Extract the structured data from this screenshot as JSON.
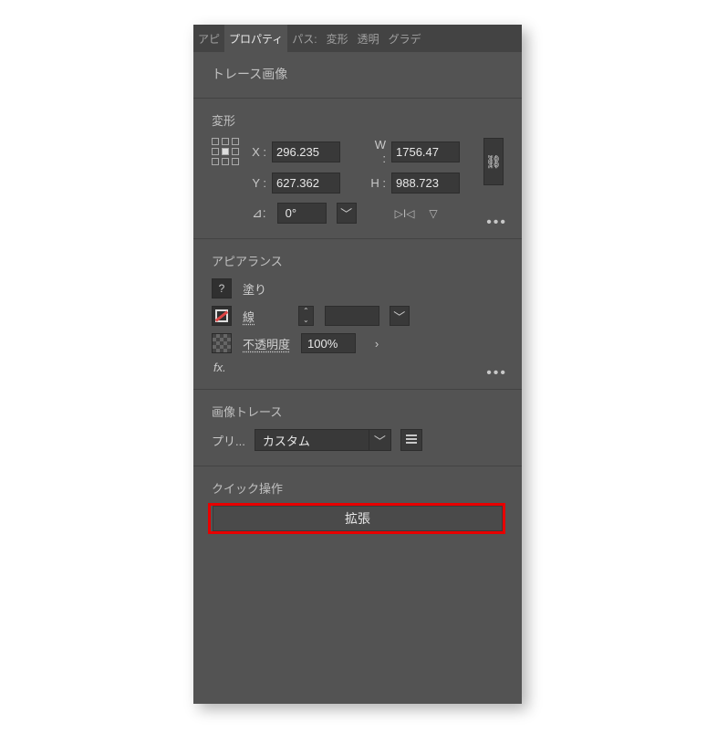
{
  "tabs": [
    "アピ",
    "プロパティ",
    "パス:",
    "変形",
    "透明",
    "グラデ"
  ],
  "active_tab": "プロパティ",
  "object_type": "トレース画像",
  "transform": {
    "title": "変形",
    "x_label": "X :",
    "y_label": "Y :",
    "w_label": "W :",
    "h_label": "H :",
    "x": "296.235",
    "y": "627.362",
    "w": "1756.47",
    "h": "988.723",
    "angle_label": "⊿:",
    "angle": "0°",
    "flip_h": "▷I◁",
    "flip_v": "▽"
  },
  "appearance": {
    "title": "アピアランス",
    "fill_label": "塗り",
    "stroke_label": "線",
    "opacity_label": "不透明度",
    "opacity": "100%",
    "fx_label": "fx."
  },
  "trace": {
    "title": "画像トレース",
    "preset_label": "プリ...",
    "preset_value": "カスタム"
  },
  "quick": {
    "title": "クイック操作",
    "expand_label": "拡張"
  }
}
